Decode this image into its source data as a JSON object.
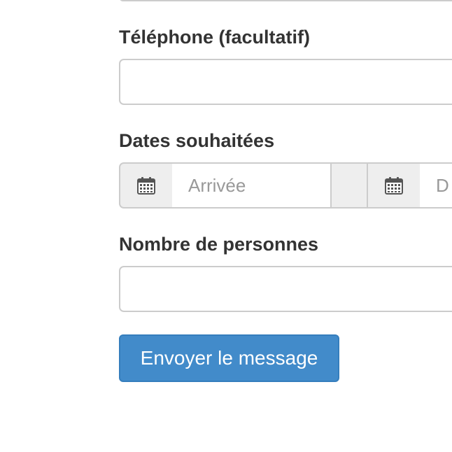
{
  "form": {
    "phone_label": "Téléphone (facultatif)",
    "phone_value": "",
    "dates_label": "Dates souhaitées",
    "arrival_placeholder": "Arrivée",
    "departure_placeholder": "D",
    "persons_label": "Nombre de personnes",
    "persons_value": "",
    "submit_label": "Envoyer le message"
  },
  "icons": {
    "arrival_icon": "calendar-icon",
    "departure_icon": "calendar-icon"
  },
  "colors": {
    "primary": "#428bca",
    "addon_bg": "#eeeeee",
    "border": "#cccccc",
    "label_text": "#333333"
  }
}
